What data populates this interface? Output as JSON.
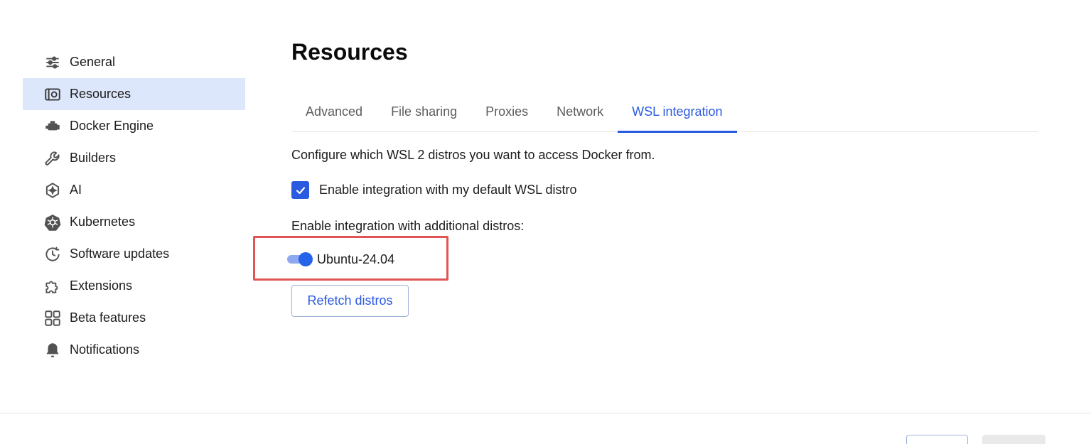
{
  "sidebar": {
    "items": [
      {
        "label": "General",
        "icon": "sliders-icon"
      },
      {
        "label": "Resources",
        "icon": "disk-icon",
        "active": true
      },
      {
        "label": "Docker Engine",
        "icon": "engine-icon"
      },
      {
        "label": "Builders",
        "icon": "wrench-icon"
      },
      {
        "label": "AI",
        "icon": "ai-sparkle-icon"
      },
      {
        "label": "Kubernetes",
        "icon": "kubernetes-icon"
      },
      {
        "label": "Software updates",
        "icon": "clock-update-icon"
      },
      {
        "label": "Extensions",
        "icon": "puzzle-icon"
      },
      {
        "label": "Beta features",
        "icon": "grid-icon"
      },
      {
        "label": "Notifications",
        "icon": "bell-icon"
      }
    ]
  },
  "main": {
    "title": "Resources",
    "tabs": [
      {
        "label": "Advanced"
      },
      {
        "label": "File sharing"
      },
      {
        "label": "Proxies"
      },
      {
        "label": "Network"
      },
      {
        "label": "WSL integration",
        "active": true
      }
    ],
    "description": "Configure which WSL 2 distros you want to access Docker from.",
    "default_distro_checkbox": {
      "label": "Enable integration with my default WSL distro",
      "checked": true
    },
    "additional_label": "Enable integration with additional distros:",
    "distros": [
      {
        "label": "Ubuntu-24.04",
        "enabled": true
      }
    ],
    "refetch_label": "Refetch distros"
  },
  "colors": {
    "accent": "#2a5ae0",
    "active_nav_bg": "#dce7fb",
    "highlight": "#e05454"
  }
}
